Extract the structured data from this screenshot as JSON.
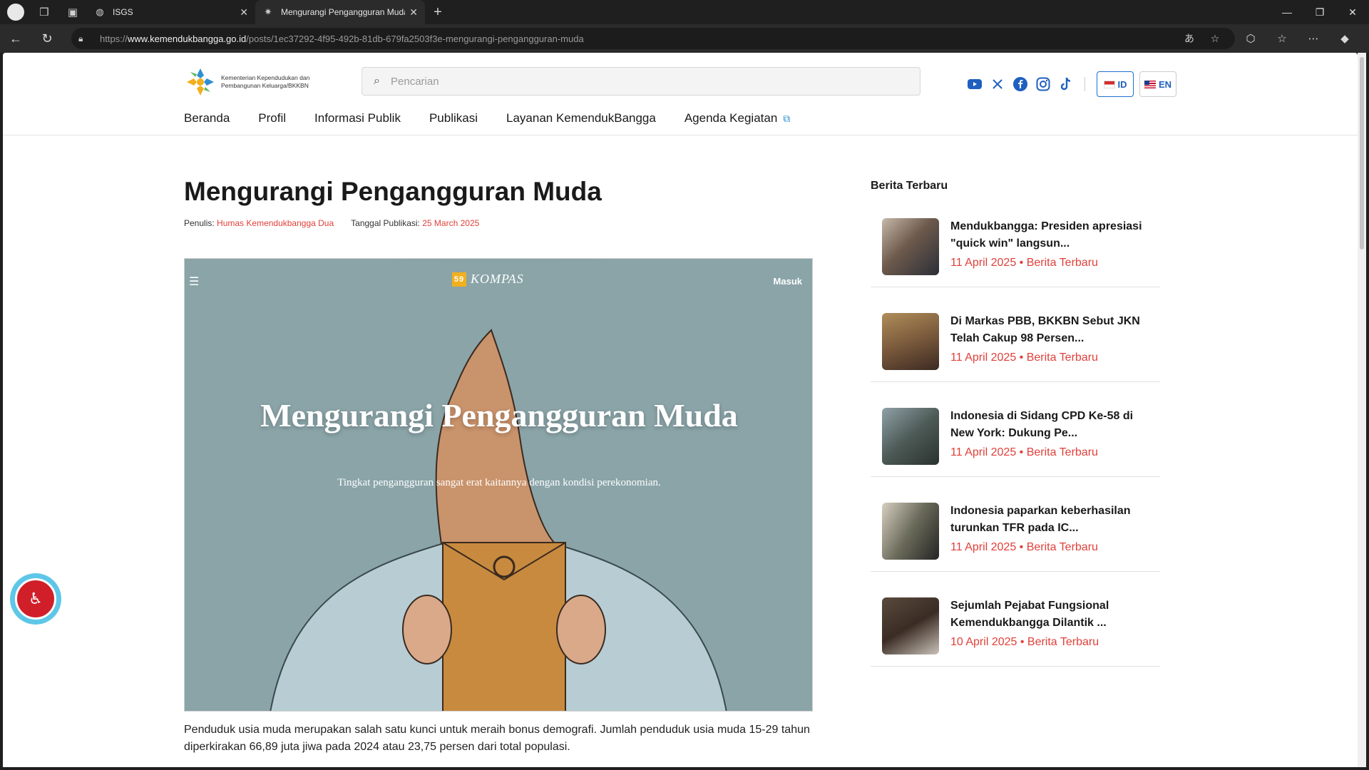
{
  "browser": {
    "tabs": [
      {
        "title": "ISGS",
        "active": false
      },
      {
        "title": "Mengurangi Pengangguran Muda",
        "active": true
      }
    ],
    "url_prefix": "https://",
    "url_domain": "www.kemendukbangga.go.id",
    "url_path": "/posts/1ec37292-4f95-492b-81db-679fa2503f3e-mengurangi-pengangguran-muda"
  },
  "site": {
    "logo_text": "Kementerian Kependudukan dan Pembangunan Keluarga/BKKBN",
    "search_placeholder": "Pencarian",
    "lang_id": "ID",
    "lang_en": "EN",
    "nav": [
      "Beranda",
      "Profil",
      "Informasi Publik",
      "Publikasi",
      "Layanan KemendukBangga",
      "Agenda Kegiatan"
    ]
  },
  "article": {
    "title": "Mengurangi Pengangguran Muda",
    "author_label": "Penulis:",
    "author": "Humas Kemendukbangga Dua",
    "date_label": "Tanggal Publikasi:",
    "date": "25 March 2025",
    "hero": {
      "brand": "KOMPAS",
      "badge": "59",
      "login": "Masuk",
      "title": "Mengurangi Pengangguran Muda",
      "subtitle": "Tingkat pengangguran sangat erat kaitannya dengan kondisi perekonomian."
    },
    "body": "Penduduk usia muda merupakan salah satu kunci untuk meraih bonus demografi. Jumlah penduduk usia muda 15-29 tahun diperkirakan 66,89 juta jiwa pada 2024 atau 23,75 persen dari total populasi."
  },
  "sidebar": {
    "title": "Berita Terbaru",
    "items": [
      {
        "headline": "Mendukbangga: Presiden apresiasi \"quick win\" langsun...",
        "date": "11 April 2025",
        "category": "Berita Terbaru",
        "meta": "11 April 2025 • Berita Terbaru"
      },
      {
        "headline": "Di Markas PBB, BKKBN Sebut JKN Telah Cakup 98 Persen...",
        "date": "11 April 2025",
        "category": "Berita Terbaru",
        "meta": "11 April 2025 • Berita Terbaru"
      },
      {
        "headline": "Indonesia di Sidang CPD Ke-58 di New York: Dukung Pe...",
        "date": "11 April 2025",
        "category": "Berita Terbaru",
        "meta": "11 April 2025 • Berita Terbaru"
      },
      {
        "headline": "Indonesia paparkan keberhasilan turunkan TFR pada IC...",
        "date": "11 April 2025",
        "category": "Berita Terbaru",
        "meta": "11 April 2025 • Berita Terbaru"
      },
      {
        "headline": "Sejumlah Pejabat Fungsional Kemendukbangga Dilantik ...",
        "date": "10 April 2025",
        "category": "Berita Terbaru",
        "meta": "10 April 2025 • Berita Terbaru"
      }
    ]
  },
  "colors": {
    "accent_red": "#e0403a",
    "link_blue": "#1f5fbf",
    "hero_bg": "#8aa4a8"
  }
}
